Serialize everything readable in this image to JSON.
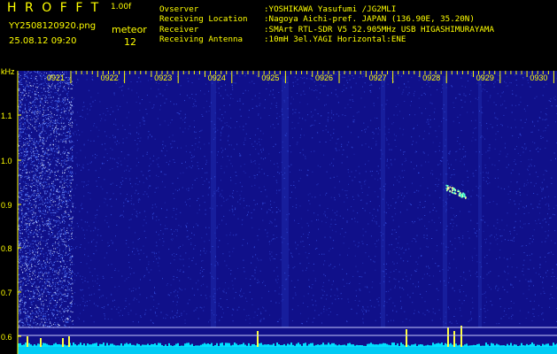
{
  "header": {
    "title": "HROFFT",
    "version": "1.00f",
    "filename": "YY2508120920.png",
    "timestamp": "25.08.12 09:20",
    "meteor_label": "meteor",
    "meteor_count": "12"
  },
  "info": [
    {
      "label": "Ovserver",
      "value": ":YOSHIKAWA Yasufumi /JG2MLI"
    },
    {
      "label": "Receiving Location",
      "value": ":Nagoya Aichi-pref. JAPAN (136.90E, 35.20N)"
    },
    {
      "label": "Receiver",
      "value": ":SMArt RTL-SDR V5 52.905MHz USB HIGASHIMURAYAMA"
    },
    {
      "label": "Receiving Antenna",
      "value": ":10mH 3el.YAGI Horizontal:ENE"
    }
  ],
  "spectrogram": {
    "y_unit": "kHz",
    "y_ticks": [
      "1.1",
      "1.0",
      "0.9",
      "0.8",
      "0.7",
      "0.6"
    ],
    "time_ticks": [
      "0921",
      "0922",
      "0923",
      "0924",
      "0925",
      "0926",
      "0927",
      "0928",
      "0929",
      "0930"
    ]
  },
  "colors": {
    "text": "#ffff00",
    "background": "#000000",
    "spectrum_bg": "#10108a",
    "noise": "#3c5cf0",
    "signal": "#4cffd0",
    "amplitude": "#00e0ff"
  }
}
